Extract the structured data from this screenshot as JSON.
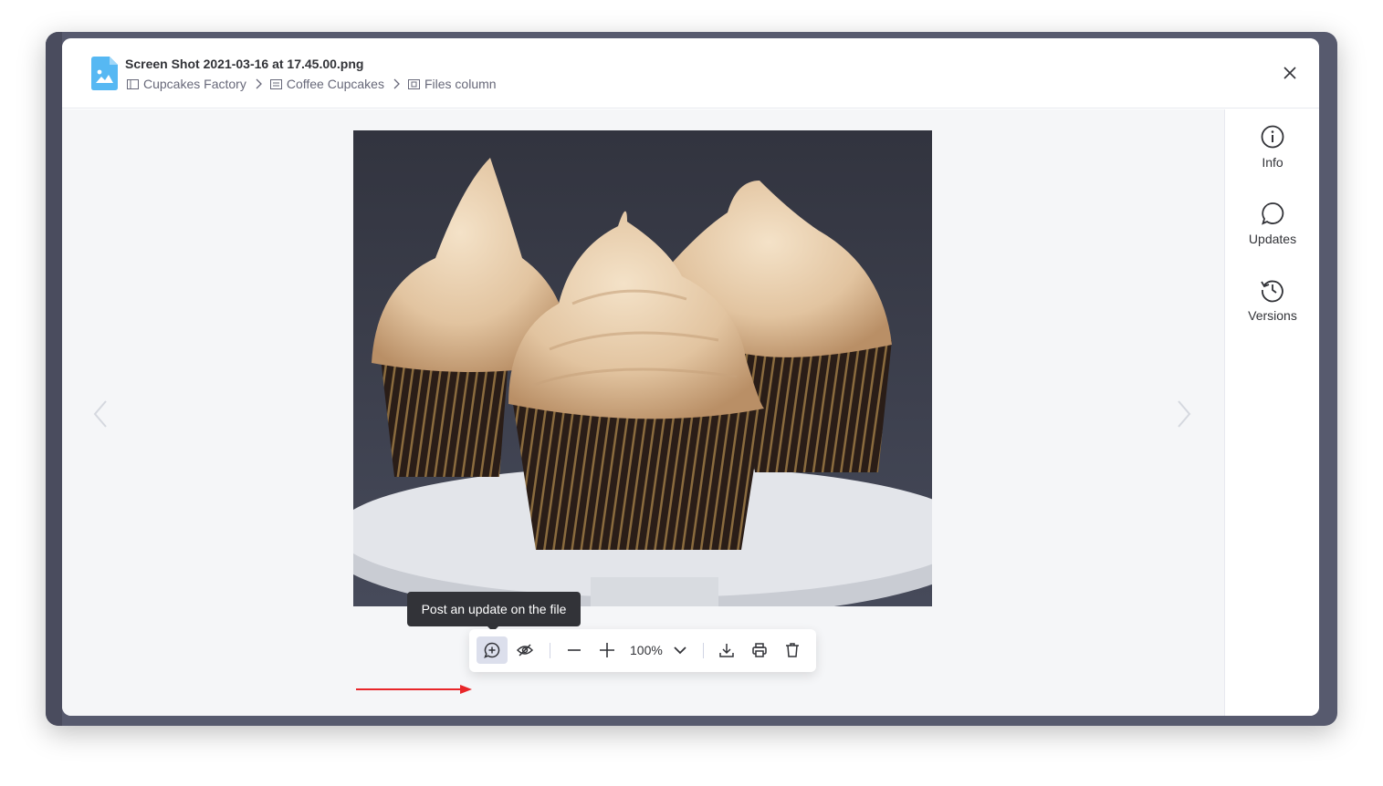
{
  "file": {
    "name": "Screen Shot 2021-03-16 at 17.45.00.png",
    "breadcrumb": [
      {
        "label": "Cupcakes Factory",
        "icon": "board-icon"
      },
      {
        "label": "Coffee Cupcakes",
        "icon": "item-icon"
      },
      {
        "label": "Files column",
        "icon": "column-icon"
      }
    ]
  },
  "sidepanel": {
    "items": [
      {
        "label": "Info",
        "icon": "info-icon"
      },
      {
        "label": "Updates",
        "icon": "chat-bubble-icon"
      },
      {
        "label": "Versions",
        "icon": "history-icon"
      }
    ]
  },
  "toolbar": {
    "tooltip": "Post an update on the file",
    "zoom": "100%"
  },
  "colors": {
    "accent_file_icon": "#56b8f3",
    "tooltip_bg": "#323338",
    "arrow": "#e8262a",
    "viewer_bg": "#f5f6f8"
  }
}
